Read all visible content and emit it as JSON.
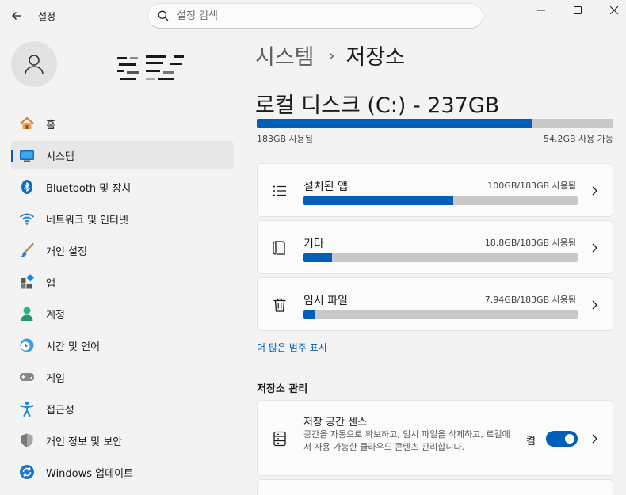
{
  "window": {
    "title": "설정",
    "back_icon": "back-arrow-icon",
    "minimize_icon": "minimize-icon",
    "maximize_icon": "maximize-icon",
    "close_icon": "close-icon"
  },
  "search": {
    "placeholder": "설정 검색",
    "icon": "search-icon"
  },
  "user": {
    "icon": "person-icon"
  },
  "sidebar": {
    "items": [
      {
        "label": "홈",
        "icon": "home-icon",
        "selected": false
      },
      {
        "label": "시스템",
        "icon": "system-icon",
        "selected": true
      },
      {
        "label": "Bluetooth 및 장치",
        "icon": "bluetooth-icon",
        "selected": false
      },
      {
        "label": "네트워크 및 인터넷",
        "icon": "wifi-icon",
        "selected": false
      },
      {
        "label": "개인 설정",
        "icon": "brush-icon",
        "selected": false
      },
      {
        "label": "앱",
        "icon": "apps-icon",
        "selected": false
      },
      {
        "label": "계정",
        "icon": "account-icon",
        "selected": false
      },
      {
        "label": "시간 및 언어",
        "icon": "clock-globe-icon",
        "selected": false
      },
      {
        "label": "게임",
        "icon": "gamepad-icon",
        "selected": false
      },
      {
        "label": "접근성",
        "icon": "accessibility-icon",
        "selected": false
      },
      {
        "label": "개인 정보 및 보안",
        "icon": "shield-icon",
        "selected": false
      },
      {
        "label": "Windows 업데이트",
        "icon": "update-icon",
        "selected": false
      }
    ]
  },
  "breadcrumb": {
    "parent": "시스템",
    "separator": "›",
    "current": "저장소"
  },
  "drive": {
    "title": "로컬 디스크 (C:) - 237GB",
    "used_label": "183GB 사용됨",
    "free_label": "54.2GB 사용 가능",
    "used_fraction": 0.77
  },
  "categories": [
    {
      "label": "설치된 앱",
      "usage": "100GB/183GB 사용됨",
      "fraction": 0.546,
      "icon": "list-icon"
    },
    {
      "label": "기타",
      "usage": "18.8GB/183GB 사용됨",
      "fraction": 0.103,
      "icon": "document-icon"
    },
    {
      "label": "임시 파일",
      "usage": "7.94GB/183GB 사용됨",
      "fraction": 0.043,
      "icon": "trash-icon"
    }
  ],
  "more_link": "더 많은 범주 표시",
  "management": {
    "title": "저장소 관리",
    "sense": {
      "title": "저장 공간 센스",
      "description": "공간을 자동으로 확보하고, 임시 파일을 삭제하고, 로컬에서 사용 가능한 클라우드 콘텐츠 관리합니다.",
      "toggle_label": "켬",
      "toggle_on": true,
      "icon": "storage-drive-icon"
    }
  },
  "colors": {
    "accent": "#005fb8",
    "track": "#c8c8c8",
    "background": "#f3f3f3",
    "card": "#fbfbfb"
  }
}
